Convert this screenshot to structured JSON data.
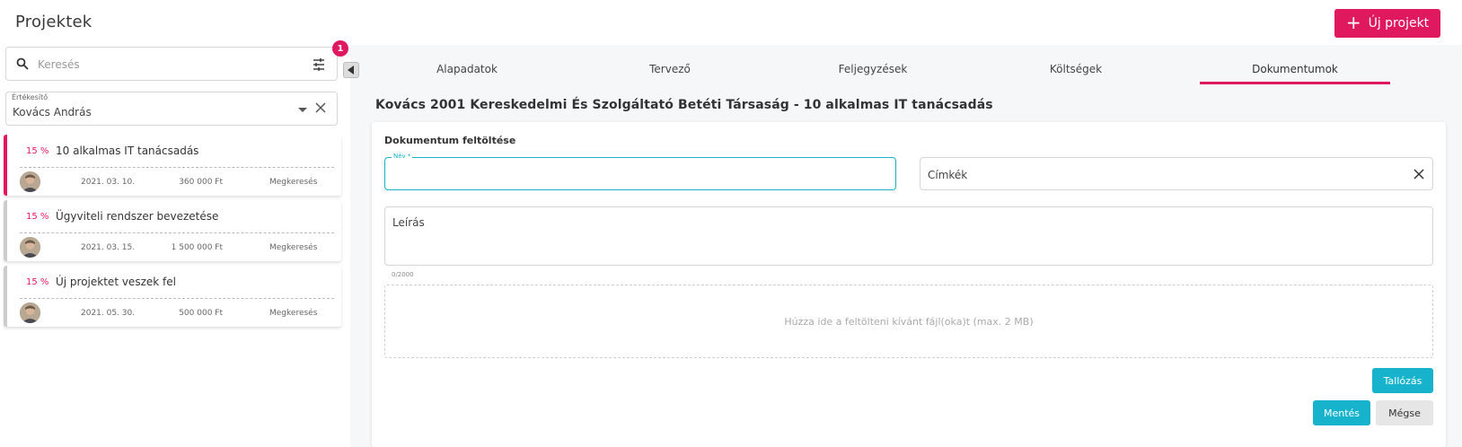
{
  "header": {
    "title": "Projektek",
    "new_project_label": "Új projekt"
  },
  "sidebar": {
    "search": {
      "placeholder": "Keresés",
      "value": ""
    },
    "filter_count": "1",
    "evaluator": {
      "label": "Értékesítő",
      "value": "Kovács András"
    },
    "projects": [
      {
        "percent": "15 %",
        "title": "10 alkalmas IT tanácsadás",
        "date": "2021. 03. 10.",
        "amount": "360 000 Ft",
        "status": "Megkeresés",
        "active": true
      },
      {
        "percent": "15 %",
        "title": "Ügyviteli rendszer bevezetése",
        "date": "2021. 03. 15.",
        "amount": "1 500 000 Ft",
        "status": "Megkeresés",
        "active": false
      },
      {
        "percent": "15 %",
        "title": "Új projektet veszek fel",
        "date": "2021. 05. 30.",
        "amount": "500 000 Ft",
        "status": "Megkeresés",
        "active": false
      }
    ]
  },
  "tabs": [
    {
      "label": "Alapadatok",
      "active": false
    },
    {
      "label": "Tervező",
      "active": false
    },
    {
      "label": "Feljegyzések",
      "active": false
    },
    {
      "label": "Költségek",
      "active": false
    },
    {
      "label": "Dokumentumok",
      "active": true
    }
  ],
  "main": {
    "project_heading": "Kovács 2001 Kereskedelmi És Szolgáltató Betéti Társaság - 10 alkalmas IT tanácsadás",
    "upload": {
      "title": "Dokumentum feltöltése",
      "name_label": "Név *",
      "name_value": "",
      "tags_placeholder": "Címkék",
      "description_placeholder": "Leírás",
      "description_counter": "0/2000",
      "drop_zone_text": "Húzza ide a feltölteni kívánt fájl(oka)t (max. 2 MB)",
      "browse_label": "Tallózás",
      "save_label": "Mentés",
      "cancel_label": "Mégse"
    }
  },
  "colors": {
    "accent": "#e0185e",
    "primary": "#17b3cd"
  }
}
